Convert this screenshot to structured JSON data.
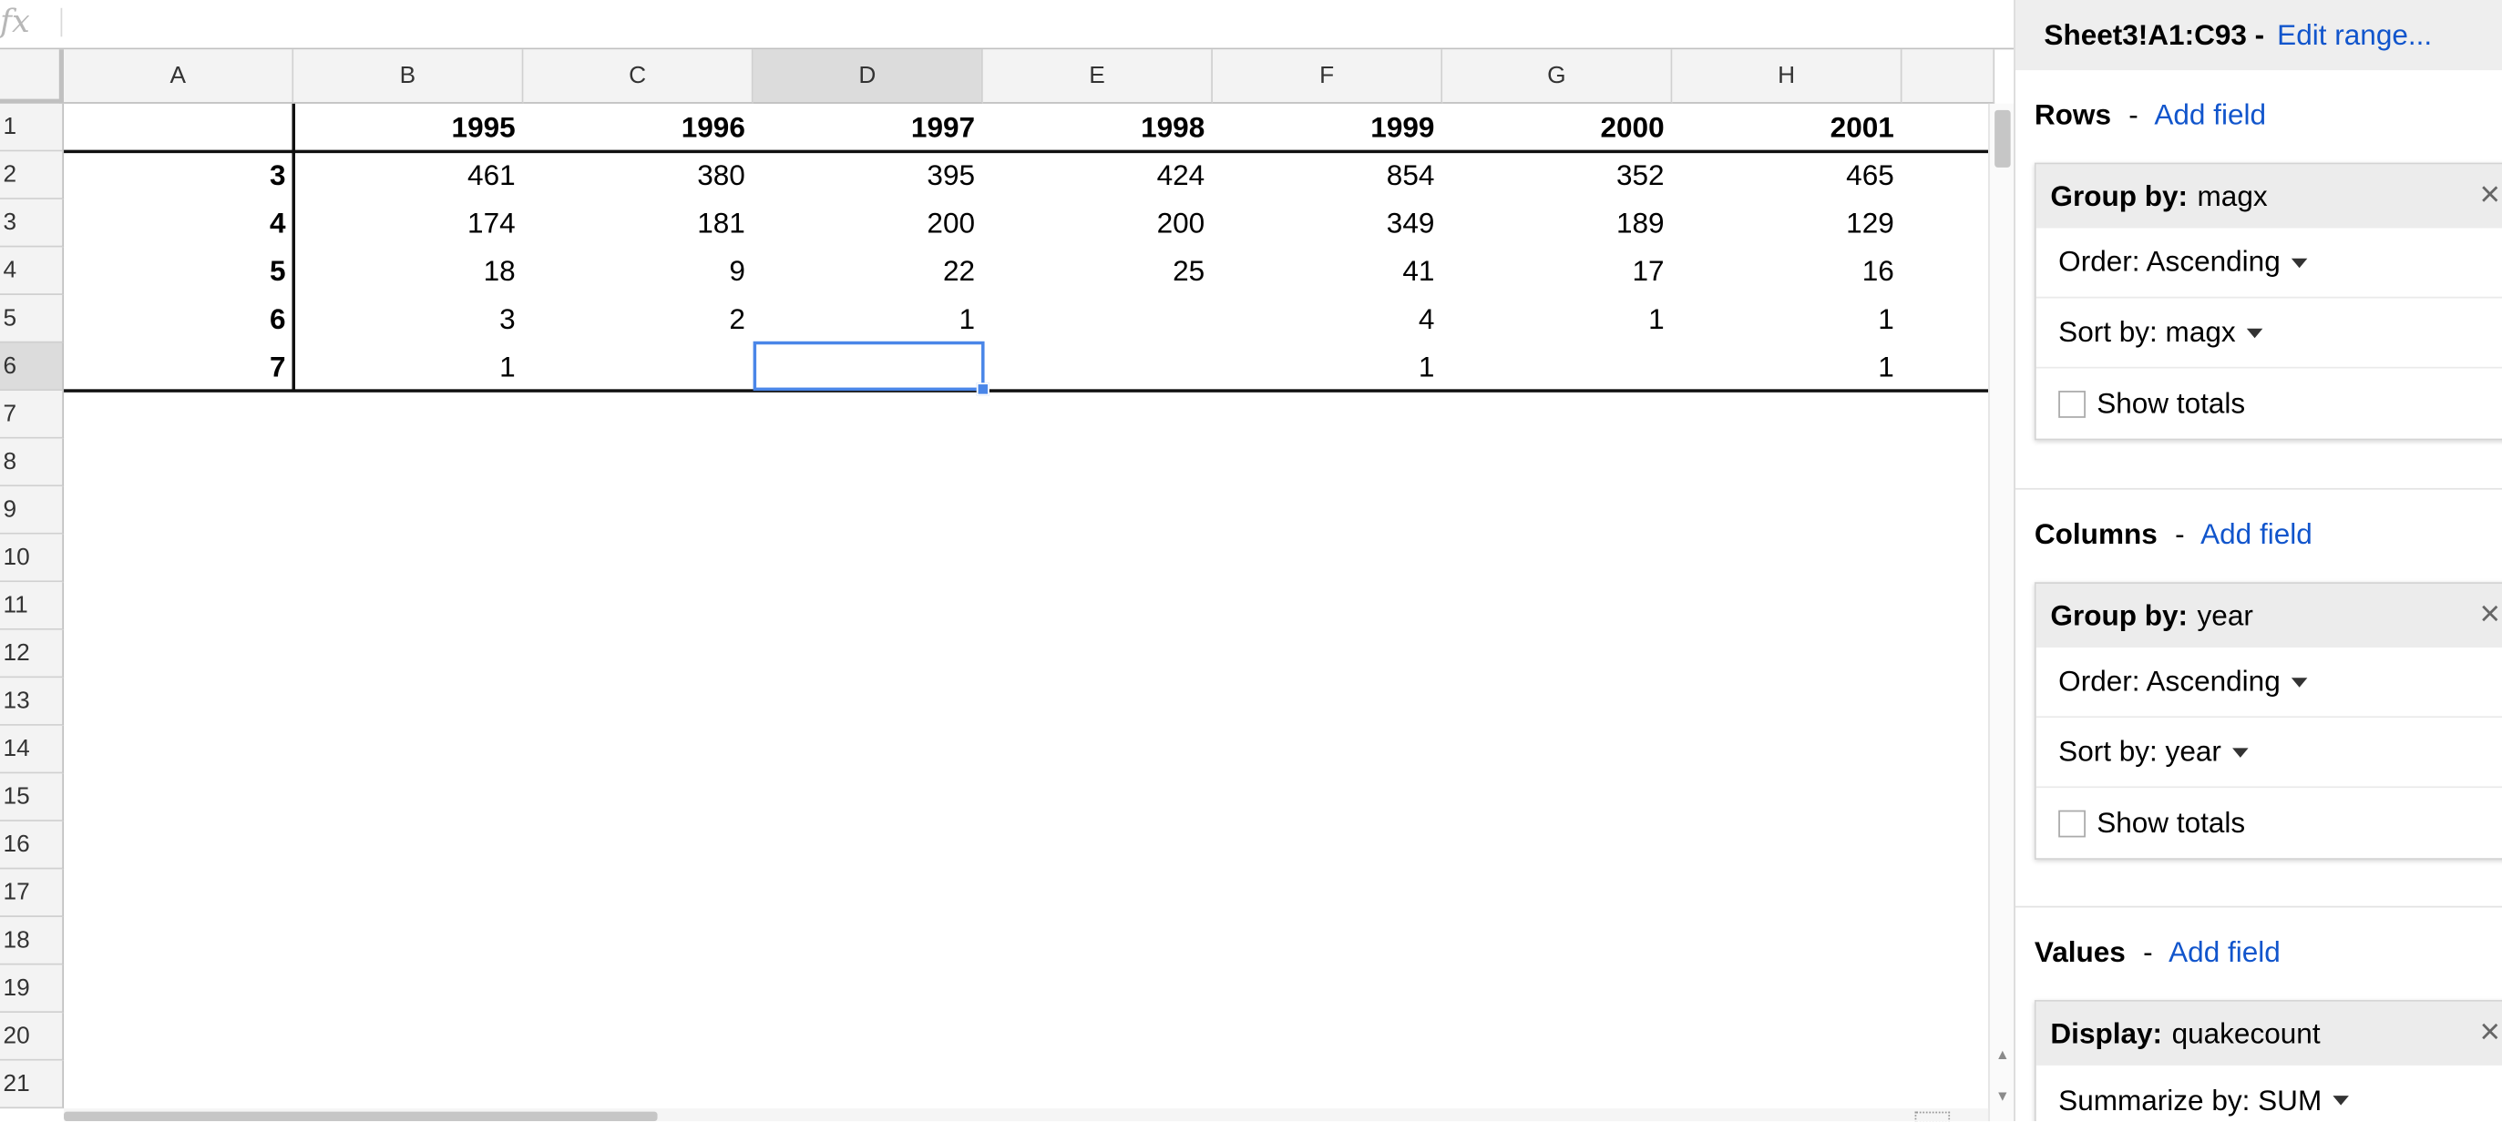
{
  "formula_bar": {
    "fx_label": "fx",
    "value": ""
  },
  "grid": {
    "columns": [
      "A",
      "B",
      "C",
      "D",
      "E",
      "F",
      "G",
      "H"
    ],
    "active_column": "D",
    "rows": [
      "1",
      "2",
      "3",
      "4",
      "5",
      "6",
      "7",
      "8",
      "9",
      "10",
      "11",
      "12",
      "13",
      "14",
      "15",
      "16",
      "17",
      "18",
      "19",
      "20",
      "21"
    ],
    "active_row": "6",
    "selected_cell": "D6",
    "cells": [
      [
        "",
        "1995",
        "1996",
        "1997",
        "1998",
        "1999",
        "2000",
        "2001"
      ],
      [
        "3",
        "461",
        "380",
        "395",
        "424",
        "854",
        "352",
        "465"
      ],
      [
        "4",
        "174",
        "181",
        "200",
        "200",
        "349",
        "189",
        "129"
      ],
      [
        "5",
        "18",
        "9",
        "22",
        "25",
        "41",
        "17",
        "16"
      ],
      [
        "6",
        "3",
        "2",
        "1",
        "",
        "4",
        "1",
        "1"
      ],
      [
        "7",
        "1",
        "",
        "",
        "",
        "1",
        "",
        "1"
      ]
    ]
  },
  "pivot_editor": {
    "range": "Sheet3!A1:C93 -",
    "edit_range_link": "Edit range...",
    "rows_section": {
      "title": "Rows",
      "separator": "-",
      "add_field": "Add field",
      "group_by_label": "Group by:",
      "group_by_value": "magx",
      "order_label": "Order: Ascending",
      "sort_by_label": "Sort by: magx",
      "show_totals_label": "Show totals",
      "show_totals_checked": false
    },
    "columns_section": {
      "title": "Columns",
      "separator": "-",
      "add_field": "Add field",
      "group_by_label": "Group by:",
      "group_by_value": "year",
      "order_label": "Order: Ascending",
      "sort_by_label": "Sort by: year",
      "show_totals_label": "Show totals",
      "show_totals_checked": false
    },
    "values_section": {
      "title": "Values",
      "separator": "-",
      "add_field": "Add field",
      "display_label": "Display:",
      "display_value": "quakecount",
      "summarize_label": "Summarize by: SUM"
    }
  },
  "colors": {
    "selection_blue": "#4a86e8",
    "link_blue": "#1155cc",
    "header_gray": "#f3f3f3",
    "active_header_gray": "#dcdcdc"
  }
}
